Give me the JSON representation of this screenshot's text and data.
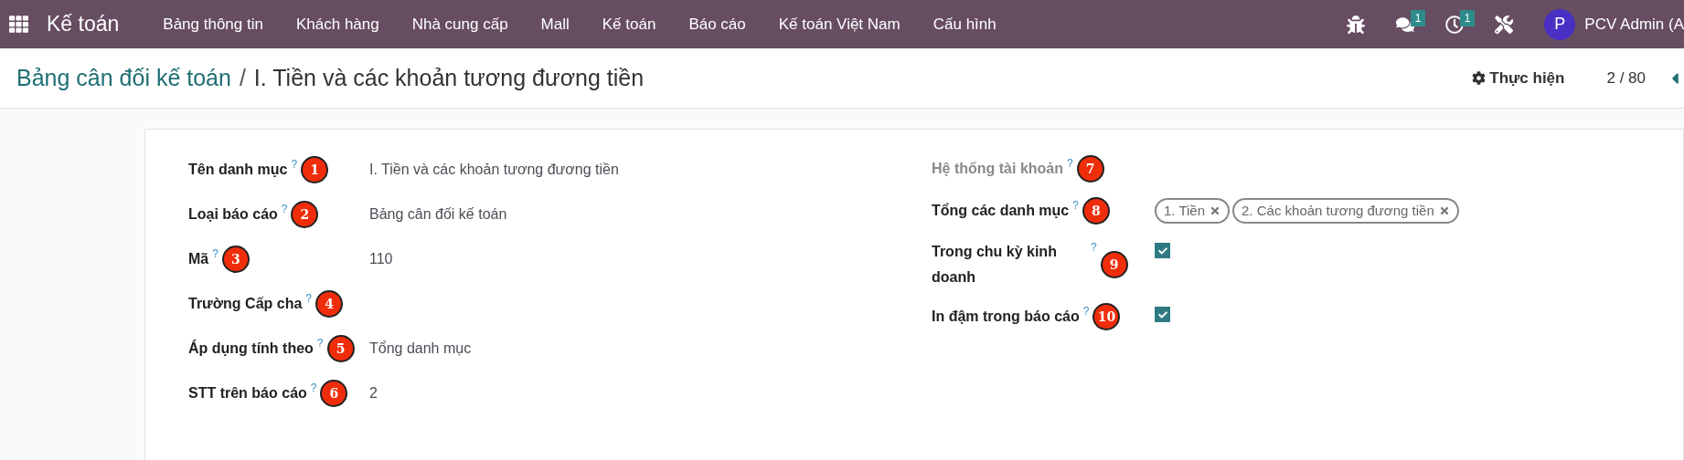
{
  "navbar": {
    "app_name": "Kế toán",
    "menu": [
      "Bảng thông tin",
      "Khách hàng",
      "Nhà cung cấp",
      "Mall",
      "Kế toán",
      "Báo cáo",
      "Kế toán Việt Nam",
      "Cấu hình"
    ],
    "systray": [
      {
        "kind": "bug"
      },
      {
        "kind": "chat",
        "count": "1"
      },
      {
        "kind": "activity",
        "count": "1"
      },
      {
        "kind": "tools"
      }
    ],
    "avatar": "P",
    "user": "PCV Admin (A"
  },
  "control_panel": {
    "breadcrumb_parent": "Bảng cân đối kế toán",
    "separator": "/",
    "breadcrumb_current": "I. Tiền và các khoản tương đương tiền",
    "action": "Thực hiện",
    "pager": "2 / 80"
  },
  "form": {
    "left": [
      {
        "label": "Tên danh mục",
        "help": "?",
        "badge": "1",
        "value": "I. Tiền và các khoản tương đương tiền"
      },
      {
        "label": "Loại báo cáo",
        "help": "?",
        "badge": "2",
        "value": "Bảng cân đối kế toán"
      },
      {
        "label": "Mã",
        "help": "?",
        "badge": "3",
        "value": "110"
      },
      {
        "label": "Trường Cấp cha",
        "help": "?",
        "badge": "4"
      },
      {
        "label": "Áp dụng tính theo",
        "help": "?",
        "badge": "5",
        "value": "Tổng danh mục"
      },
      {
        "label": "STT trên báo cáo",
        "help": "?",
        "badge": "6",
        "value": "2"
      }
    ],
    "right": [
      {
        "kind": "text",
        "label": "Hệ thống tài khoản",
        "help": "?",
        "badge": "7",
        "muted": true
      },
      {
        "kind": "tags",
        "label": "Tổng các danh mục",
        "help": "?",
        "badge": "8",
        "muted": false,
        "tags": [
          "1. Tiền",
          "2. Các khoản tương đương tiền"
        ]
      },
      {
        "kind": "checkbox",
        "label": "Trong chu kỳ kinh doanh",
        "help": "?",
        "badge": "9",
        "muted": false,
        "checked": true
      },
      {
        "kind": "checkbox",
        "label": "In đậm trong báo cáo",
        "help": "?",
        "badge": "10",
        "muted": false,
        "checked": true
      }
    ]
  }
}
